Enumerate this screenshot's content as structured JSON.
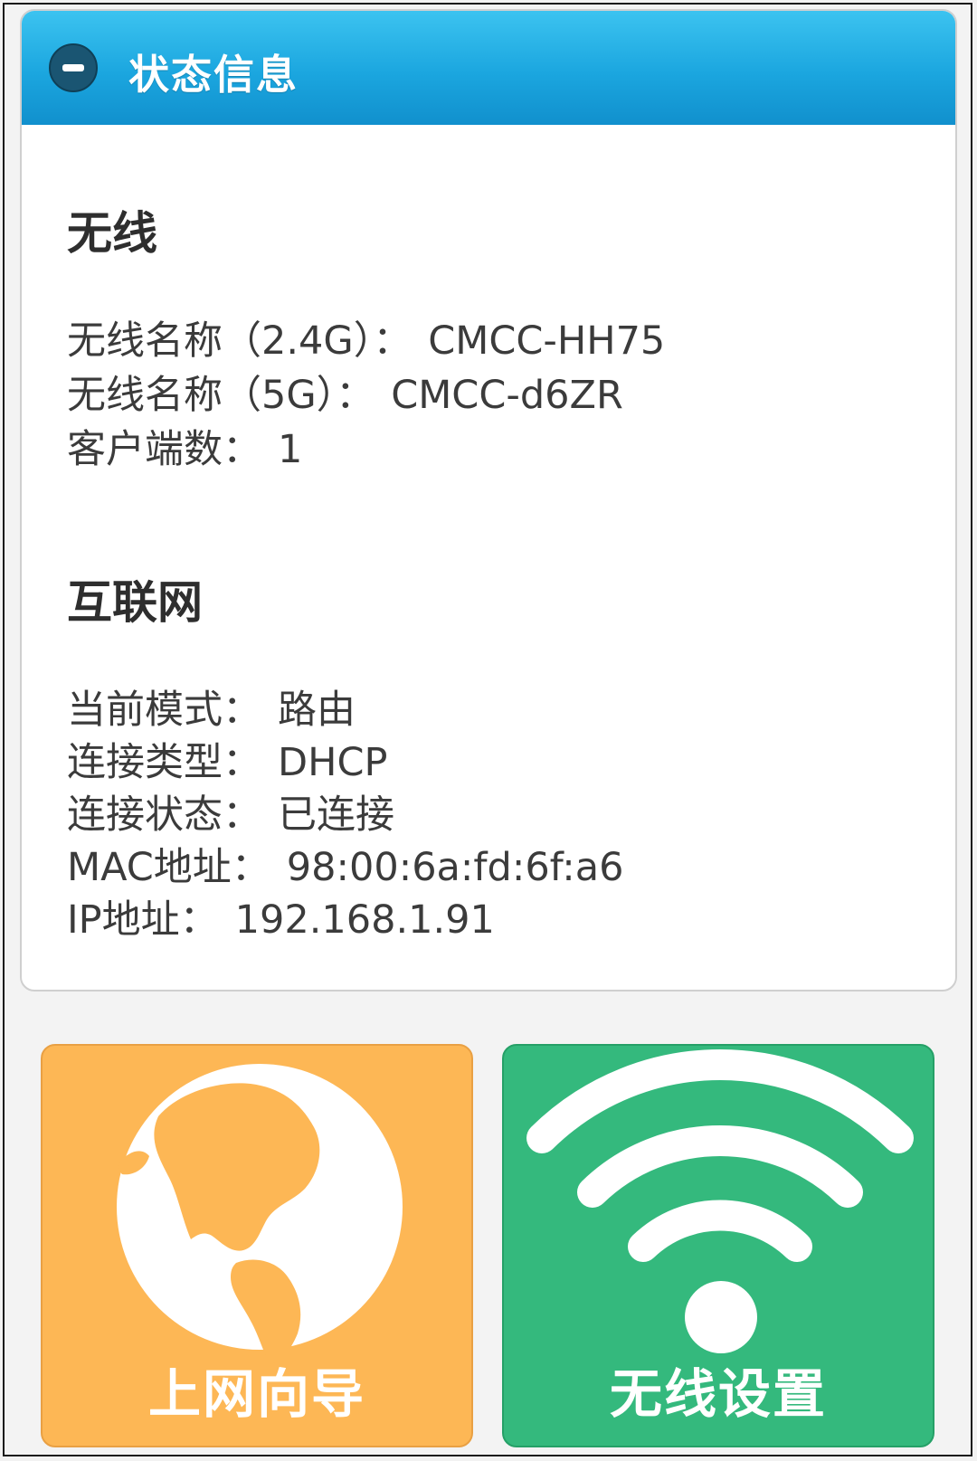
{
  "header": {
    "title": "状态信息"
  },
  "wireless": {
    "section_title": "无线",
    "ssid_24g_label": "无线名称（2.4G）：",
    "ssid_24g_value": "CMCC-HH75",
    "ssid_5g_label": "无线名称（5G）：",
    "ssid_5g_value": "CMCC-d6ZR",
    "clients_label": "客户端数：",
    "clients_value": "1"
  },
  "internet": {
    "section_title": "互联网",
    "mode_label": "当前模式：",
    "mode_value": "路由",
    "conn_type_label": "连接类型：",
    "conn_type_value": "DHCP",
    "conn_status_label": "连接状态：",
    "conn_status_value": "已连接",
    "mac_label": "MAC地址：",
    "mac_value": "98:00:6a:fd:6f:a6",
    "ip_label": "IP地址：",
    "ip_value": "192.168.1.91"
  },
  "tiles": {
    "wizard": {
      "label": "上网向导",
      "icon": "globe-icon",
      "color": "#fdb755"
    },
    "wifi_settings": {
      "label": "无线设置",
      "icon": "wifi-icon",
      "color": "#34b97d"
    }
  },
  "colors": {
    "header_accent": "#1ba6df"
  }
}
